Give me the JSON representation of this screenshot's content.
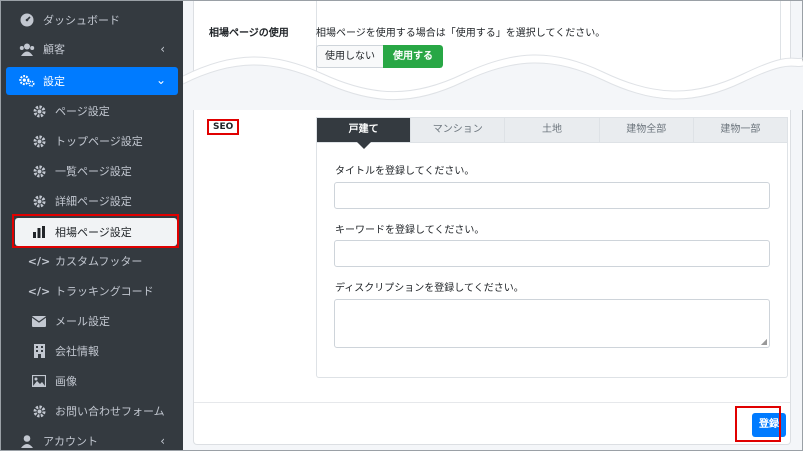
{
  "sidebar": {
    "items": [
      {
        "label": "ダッシュボード",
        "icon": "tachometer-icon"
      },
      {
        "label": "顧客",
        "icon": "users-icon"
      },
      {
        "label": "設定",
        "icon": "cogs-icon"
      },
      {
        "label": "ページ設定",
        "icon": "gear-icon"
      },
      {
        "label": "トップページ設定",
        "icon": "gear-icon"
      },
      {
        "label": "一覧ページ設定",
        "icon": "gear-icon"
      },
      {
        "label": "詳細ページ設定",
        "icon": "gear-icon"
      },
      {
        "label": "相場ページ設定",
        "icon": "bar-chart-icon"
      },
      {
        "label": "カスタムフッター",
        "icon": "code-icon"
      },
      {
        "label": "トラッキングコード",
        "icon": "code-icon"
      },
      {
        "label": "メール設定",
        "icon": "envelope-icon"
      },
      {
        "label": "会社情報",
        "icon": "building-icon"
      },
      {
        "label": "画像",
        "icon": "image-icon"
      },
      {
        "label": "お問い合わせフォーム",
        "icon": "gear-icon"
      },
      {
        "label": "アカウント",
        "icon": "user-icon"
      }
    ],
    "active_color": "#007bff"
  },
  "usage": {
    "label": "相場ページの使用",
    "help": "相場ページを使用する場合は「使用する」を選択してください。",
    "off_label": "使用しない",
    "on_label": "使用する",
    "selected": "使用する"
  },
  "seo": {
    "label": "SEO",
    "tabs": [
      "戸建て",
      "マンション",
      "土地",
      "建物全部",
      "建物一部"
    ],
    "active_tab": "戸建て",
    "title_label": "タイトルを登録してください。",
    "title_value": "",
    "keywords_label": "キーワードを登録してください。",
    "keywords_value": "",
    "description_label": "ディスクリプションを登録してください。",
    "description_value": ""
  },
  "footer": {
    "submit_label": "登録"
  }
}
